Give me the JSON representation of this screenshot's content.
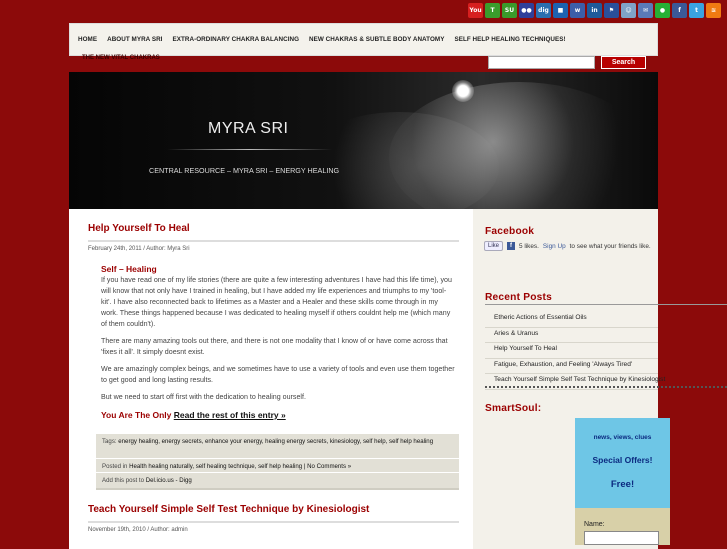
{
  "social_icons": [
    {
      "name": "youtube-icon",
      "label": "You",
      "color": "#d71f1f"
    },
    {
      "name": "technorati-icon",
      "label": "T",
      "color": "#3b9d2c"
    },
    {
      "name": "stumbleupon-icon",
      "label": "SU",
      "color": "#3a9a2a"
    },
    {
      "name": "flickr-icon",
      "label": "●●",
      "color": "#2f3f9a"
    },
    {
      "name": "digg-icon",
      "label": "dig",
      "color": "#2a6fb0"
    },
    {
      "name": "delicious-icon",
      "label": "■",
      "color": "#1d62b0"
    },
    {
      "name": "mixx-icon",
      "label": "w",
      "color": "#3c5ea8"
    },
    {
      "name": "linkedin-icon",
      "label": "in",
      "color": "#1f5a9a"
    },
    {
      "name": "myspace-icon",
      "label": "⚑",
      "color": "#2a4f9a"
    },
    {
      "name": "reddit-icon",
      "label": "☺",
      "color": "#7fa3c8"
    },
    {
      "name": "friendfeed-icon",
      "label": "✉",
      "color": "#5a7ab8"
    },
    {
      "name": "chat-icon",
      "label": "●",
      "color": "#26b035"
    },
    {
      "name": "facebook-icon",
      "label": "f",
      "color": "#3b5998"
    },
    {
      "name": "twitter-icon",
      "label": "t",
      "color": "#3aa3e0"
    },
    {
      "name": "rss-icon",
      "label": "≋",
      "color": "#f07a12"
    }
  ],
  "nav": {
    "items": [
      "HOME",
      "ABOUT MYRA SRI",
      "EXTRA-ORDINARY CHAKRA BALANCING",
      "NEW CHAKRAS & SUBTLE BODY ANATOMY",
      "SELF HELP HEALING TECHNIQUES!"
    ],
    "subitem": "THE NEW VITAL CHAKRAS"
  },
  "search": {
    "value": "",
    "button": "Search"
  },
  "header": {
    "title": "MYRA SRI",
    "tagline": "CENTRAL RESOURCE – MYRA SRI – ENERGY HEALING"
  },
  "posts": [
    {
      "title": "Help Yourself To Heal",
      "meta": "February 24th, 2011  / Author: Myra Sri",
      "subheading": "Self – Healing",
      "paragraphs": [
        "If you have read one of my life stories (there are quite a few interesting adventures I have had this life time), you will know that not only have I trained in healing, but I have added my life experiences and triumphs to my 'tool-kit'.  I have also reconnected back to lifetimes as a Master and a Healer and these skills come through in my work.  These things happened because I was dedicated to healing myself if others couldnt help me (which many of them couldn't).",
        "There are many amazing tools out there, and there is not one modality that I know of or have come across that 'fixes it all'.  It simply doesnt exist.",
        "We are amazingly complex beings, and we sometimes have to use a variety of tools and even use them together to get good and long lasting results.",
        "But we need to start off first with the dedication to healing ourself."
      ],
      "readmore_prefix": "You Are The Only",
      "readmore_link": "Read the rest of this entry »",
      "tags_label": "Tags:",
      "tags": "energy healing, energy secrets, enhance your energy, healing energy secrets, kinesiology, self help, self help healing",
      "posted_label": "Posted in",
      "posted": "Health healing naturally, self healing technique, self help healing",
      "comments": "| No Comments »",
      "share_label": "Add this post to",
      "share": "Del.icio.us - Digg"
    },
    {
      "title": "Teach Yourself Simple Self Test Technique by Kinesiologist",
      "meta": "November 19th, 2010  / Author: admin"
    }
  ],
  "sidebar": {
    "facebook_heading": "Facebook",
    "fb_like": "Like",
    "fb_text_pre": "5 likes.",
    "fb_signup": "Sign Up",
    "fb_text_post": "to see what your friends like.",
    "recent_heading": "Recent Posts",
    "recent_posts": [
      "Etheric Actions of Essential Oils",
      "Aries & Uranus",
      "Help Yourself To Heal",
      "Fatigue, Exhaustion, and Feeling 'Always Tired'",
      "Teach Yourself Simple Self Test Technique by Kinesiologist"
    ],
    "smartsoul_heading": "SmartSoul:",
    "smartsoul": {
      "line1": "news, views, clues",
      "line2": "Special Offers!",
      "line3": "Free!",
      "name_label": "Name:"
    }
  }
}
